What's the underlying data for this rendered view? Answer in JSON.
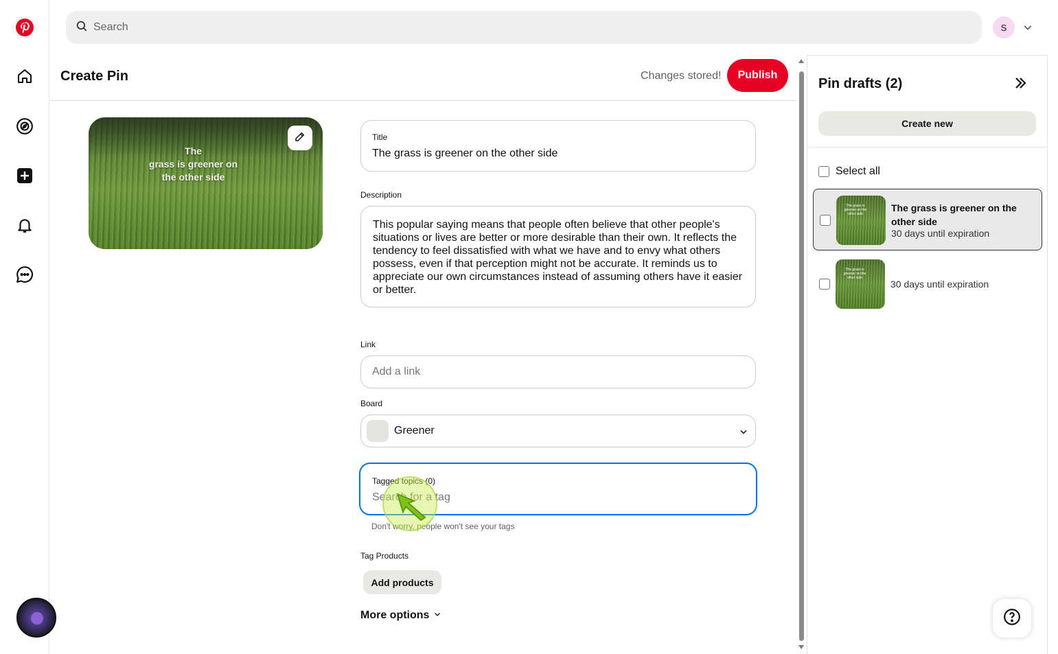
{
  "brand_color": "#e60023",
  "search": {
    "placeholder": "Search"
  },
  "user": {
    "avatar_initial": "S"
  },
  "sidebar": {
    "items": [
      {
        "name": "pinterest-logo-icon"
      },
      {
        "name": "home-icon"
      },
      {
        "name": "explore-icon"
      },
      {
        "name": "create-icon"
      },
      {
        "name": "notifications-icon"
      },
      {
        "name": "messages-icon"
      }
    ]
  },
  "header": {
    "title": "Create Pin",
    "status": "Changes stored!",
    "publish_label": "Publish"
  },
  "preview": {
    "overlay_line1": "The",
    "overlay_line2": "grass is greener on",
    "overlay_line3": "the other side"
  },
  "form": {
    "title_label": "Title",
    "title_value": "The grass is greener on the other side",
    "description_label": "Description",
    "description_value": "This popular saying means that people often believe that other people's situations or lives are better or more desirable than their own. It reflects the tendency to feel dissatisfied with what we have and to envy what others possess, even if that perception might not be accurate. It reminds us to appreciate our own circumstances instead of assuming others have it easier or better.",
    "link_label": "Link",
    "link_placeholder": "Add a link",
    "board_label": "Board",
    "board_value": "Greener",
    "tags_label": "Tagged topics (0)",
    "tags_placeholder": "Search for a tag",
    "tags_hint": "Don't worry, people won't see your tags",
    "products_label": "Tag Products",
    "add_products_label": "Add products",
    "more_options_label": "More options"
  },
  "drafts": {
    "title": "Pin drafts (2)",
    "create_new_label": "Create new",
    "select_all_label": "Select all",
    "items": [
      {
        "title": "The grass is greener on the other side",
        "expiration": "30 days until expiration",
        "thumb_text": "The grass is greener on the other side"
      },
      {
        "title": "",
        "expiration": "30 days until expiration",
        "thumb_text": "The grass is greener on the other side"
      }
    ]
  }
}
